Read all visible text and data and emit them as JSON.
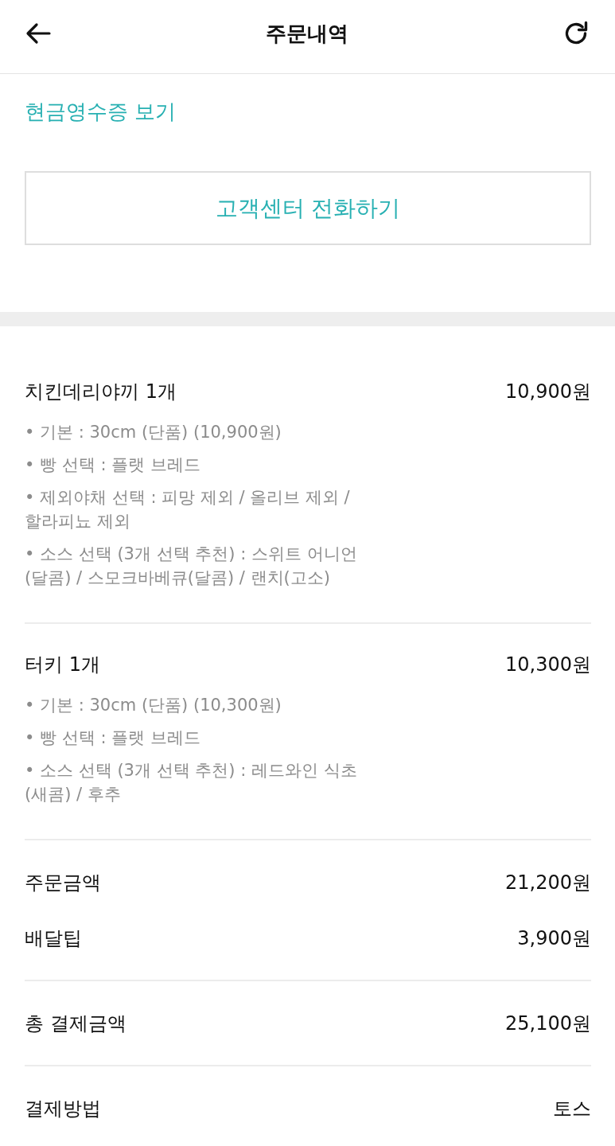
{
  "header": {
    "title": "주문내역"
  },
  "receipt_link": "현금영수증 보기",
  "call_button": "고객센터 전화하기",
  "items": [
    {
      "name": "치킨데리야끼 1개",
      "price": "10,900원",
      "options": [
        "• 기본 : 30cm (단품) (10,900원)",
        "• 빵 선택 : 플랫 브레드",
        "• 제외야채 선택 : 피망 제외 / 올리브 제외 / 할라피뇨 제외",
        "• 소스 선택 (3개 선택 추천) : 스위트 어니언 (달콤) / 스모크바베큐(달콤) / 랜치(고소)"
      ]
    },
    {
      "name": "터키 1개",
      "price": "10,300원",
      "options": [
        "• 기본 : 30cm (단품) (10,300원)",
        "• 빵 선택 : 플랫 브레드",
        "• 소스 선택 (3개 선택 추천) : 레드와인 식초 (새콤) / 후추"
      ]
    }
  ],
  "summary": [
    [
      {
        "label": "주문금액",
        "value": "21,200원"
      },
      {
        "label": "배달팁",
        "value": "3,900원"
      }
    ],
    [
      {
        "label": "총 결제금액",
        "value": "25,100원"
      }
    ],
    [
      {
        "label": "결제방법",
        "value": "토스"
      }
    ]
  ]
}
